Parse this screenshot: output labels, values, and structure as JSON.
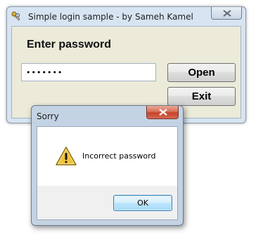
{
  "main_window": {
    "title": "Simple login sample - by Sameh Kamel",
    "prompt": "Enter password",
    "password_value": "•••••••",
    "open_label": "Open",
    "exit_label": "Exit",
    "icons": {
      "app": "keys-icon",
      "close": "close-icon"
    }
  },
  "dialog": {
    "title": "Sorry",
    "message": "Incorrect password",
    "ok_label": "OK",
    "icons": {
      "warning": "warning-icon",
      "close": "close-icon"
    }
  },
  "colors": {
    "window_frame": "#d7e4f2",
    "client_background": "#ecead9",
    "dialog_close_red": "#c7422b",
    "ok_button_blue": "#a7d9f5"
  }
}
